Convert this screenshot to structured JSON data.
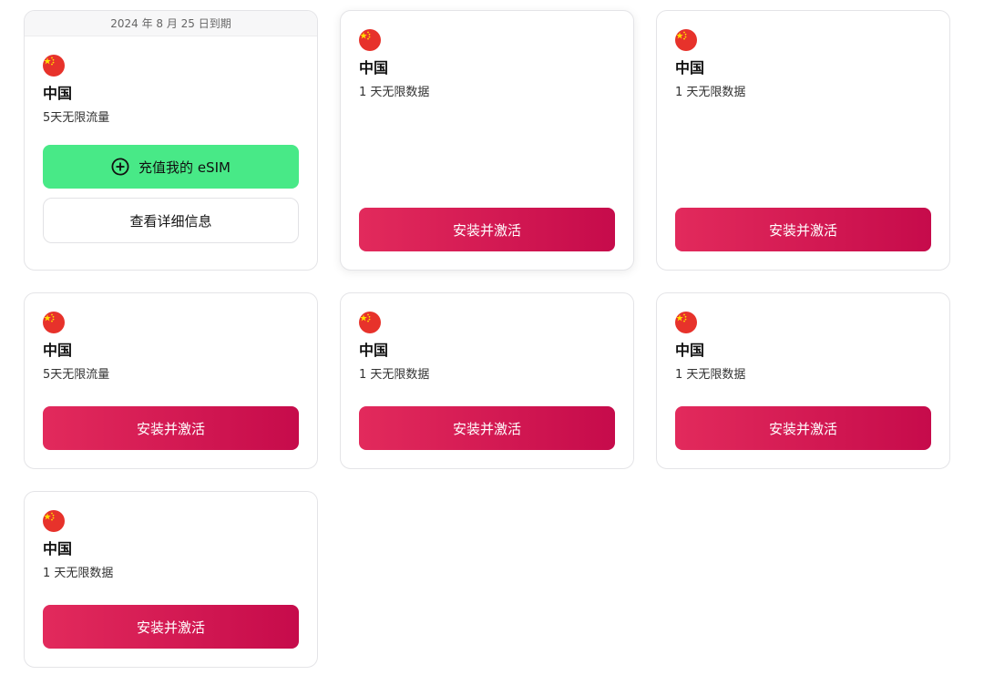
{
  "colors": {
    "activate_gradient_start": "#e22a5c",
    "activate_gradient_end": "#c60b4b",
    "topup_green": "#48e987",
    "flag_red": "#e7322b",
    "flag_star": "#ffde00"
  },
  "cards": [
    {
      "expiry": "2024 年 8 月 25 日到期",
      "flag_icon": "china-flag-icon",
      "country": "中国",
      "plan": "5天无限流量",
      "topup_label": "充值我的 eSIM",
      "topup_icon": "plus-circle-icon",
      "details_label": "查看详细信息"
    },
    {
      "flag_icon": "china-flag-icon",
      "country": "中国",
      "plan": "1 天无限数据",
      "button_label": "安装并激活"
    },
    {
      "flag_icon": "china-flag-icon",
      "country": "中国",
      "plan": "1 天无限数据",
      "button_label": "安装并激活"
    },
    {
      "flag_icon": "china-flag-icon",
      "country": "中国",
      "plan": "5天无限流量",
      "button_label": "安装并激活"
    },
    {
      "flag_icon": "china-flag-icon",
      "country": "中国",
      "plan": "1 天无限数据",
      "button_label": "安装并激活"
    },
    {
      "flag_icon": "china-flag-icon",
      "country": "中国",
      "plan": "1 天无限数据",
      "button_label": "安装并激活"
    },
    {
      "flag_icon": "china-flag-icon",
      "country": "中国",
      "plan": "1 天无限数据",
      "button_label": "安装并激活"
    }
  ]
}
